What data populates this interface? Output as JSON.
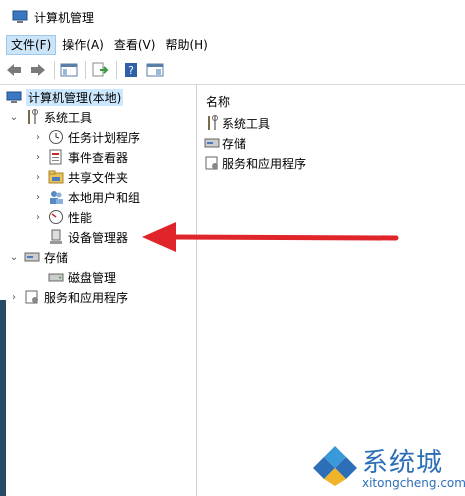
{
  "window": {
    "title": "计算机管理"
  },
  "menu": [
    {
      "label": "文件(F)",
      "active": true
    },
    {
      "label": "操作(A)",
      "active": false
    },
    {
      "label": "查看(V)",
      "active": false
    },
    {
      "label": "帮助(H)",
      "active": false
    }
  ],
  "toolbar": {
    "buttons": [
      "back-icon",
      "forward-icon",
      "show-tree-icon",
      "export-list-icon",
      "help-icon",
      "properties-pane-icon"
    ]
  },
  "tree": {
    "root": "计算机管理(本地)",
    "system_tools": "系统工具",
    "task_scheduler": "任务计划程序",
    "event_viewer": "事件查看器",
    "shared_folders": "共享文件夹",
    "local_users": "本地用户和组",
    "performance": "性能",
    "device_manager": "设备管理器",
    "storage": "存储",
    "disk_management": "磁盘管理",
    "services_apps": "服务和应用程序"
  },
  "list": {
    "column_name": "名称",
    "items": [
      "系统工具",
      "存储",
      "服务和应用程序"
    ]
  },
  "watermark": {
    "cn": "系统城",
    "en": "xitongcheng.com"
  },
  "colors": {
    "accent": "#cce4f7",
    "arrow": "#e0252a",
    "watermark": "#2c6fb7"
  }
}
